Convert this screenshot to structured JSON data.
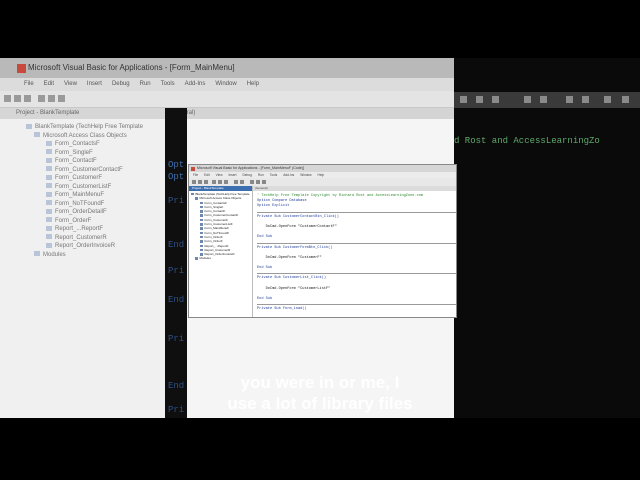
{
  "background_window": {
    "title": "Microsoft Visual Basic for Applications - [Form_MainMenu]",
    "menu": [
      "File",
      "Edit",
      "View",
      "Insert",
      "Debug",
      "Run",
      "Tools",
      "Add-Ins",
      "Window",
      "Help"
    ],
    "project_header": "Project - BlankTemplate",
    "code_header": "(General)",
    "tree": [
      "BlankTemplate (TechHelp Free Template",
      "Microsoft Access Class Objects",
      "Form_ContactsF",
      "Form_SingleF",
      "Form_ContactF",
      "Form_CustomerContactF",
      "Form_CustomerF",
      "Form_CustomerListF",
      "Form_MainMenuF",
      "Form_NoTFoundF",
      "Form_OrderDetailF",
      "Form_OrderF",
      "Report_...ReportF",
      "Report_CustomerR",
      "Report_OrderInvoiceR",
      "Modules"
    ]
  },
  "dark_fragments": {
    "right_top": "d Rost and AccessLearningZo",
    "left": [
      "Opt",
      "Opt",
      "Pri",
      "End",
      "Pri",
      "End",
      "Pri",
      "End",
      "Pri"
    ]
  },
  "mini_window": {
    "title": "Microsoft Visual Basic for Applications - [Form_MainMenuF (Code)]",
    "menu": [
      "File",
      "Edit",
      "View",
      "Insert",
      "Debug",
      "Run",
      "Tools",
      "Add-Ins",
      "Window",
      "Help"
    ],
    "project_header": "Project - BlankTemplate",
    "code_header": "(General)",
    "tree": [
      "BlankTemplate (TechHelp Free Template",
      "Microsoft Access Class Objects",
      "Form_ContactsF",
      "Form_SingleF",
      "Form_ContactF",
      "Form_CustomerContactF",
      "Form_CustomerF",
      "Form_CustomerListF",
      "Form_MainMenuF",
      "Form_NoTFoundF",
      "Form_OrderF",
      "Form_OrderF",
      "Report_...ReportF",
      "Report_CustomerR",
      "Report_OrderInvoiceR",
      "Modules"
    ],
    "code_lines": [
      {
        "text": "' TechHelp Free Template Copyright by Richard Rost and AccessLearningZone.com",
        "cls": "comment"
      },
      {
        "text": "Option Compare Database",
        "cls": "kw"
      },
      {
        "text": "Option Explicit",
        "cls": "kw"
      },
      {
        "text": "",
        "cls": "sep"
      },
      {
        "text": "Private Sub CustomerContactBtn_Click()",
        "cls": "kw"
      },
      {
        "text": "",
        "cls": "plain"
      },
      {
        "text": "    DoCmd.OpenForm \"CustomerContactF\"",
        "cls": "plain"
      },
      {
        "text": "",
        "cls": "plain"
      },
      {
        "text": "End Sub",
        "cls": "kw"
      },
      {
        "text": "",
        "cls": "sep"
      },
      {
        "text": "Private Sub CustomerFormBtn_Click()",
        "cls": "kw"
      },
      {
        "text": "",
        "cls": "plain"
      },
      {
        "text": "    DoCmd.OpenForm \"CustomerF\"",
        "cls": "plain"
      },
      {
        "text": "",
        "cls": "plain"
      },
      {
        "text": "End Sub",
        "cls": "kw"
      },
      {
        "text": "",
        "cls": "sep"
      },
      {
        "text": "Private Sub CustomerList_Click()",
        "cls": "kw"
      },
      {
        "text": "",
        "cls": "plain"
      },
      {
        "text": "    DoCmd.OpenForm \"CustomerListF\"",
        "cls": "plain"
      },
      {
        "text": "",
        "cls": "plain"
      },
      {
        "text": "End Sub",
        "cls": "kw"
      },
      {
        "text": "",
        "cls": "sep"
      },
      {
        "text": "Private Sub Form_Load()",
        "cls": "kw"
      }
    ]
  },
  "subtitle": {
    "line1": "you were in or me, I",
    "line2": "use a lot of library files"
  }
}
